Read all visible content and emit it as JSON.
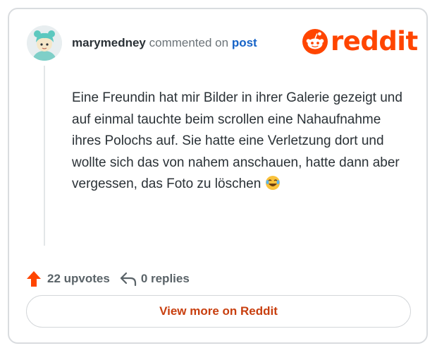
{
  "comment": {
    "username": "marymedney",
    "action_text": "commented on",
    "post_link": "post",
    "body": "Eine Freundin hat mir Bilder in ihrer Galerie gezeigt und auf einmal tauchte beim scrollen eine Nahaufnahme ihres Polochs auf. Sie hatte eine Verletzung dort und wollte sich das von nahem anschauen, hatte dann aber vergessen, das Foto zu löschen",
    "emoji": "face-with-tears-of-joy-icon"
  },
  "brand": {
    "logo_text": "reddit",
    "color": "#ff4500"
  },
  "footer": {
    "upvotes": "22 upvotes",
    "replies": "0 replies",
    "upvote_icon": "upvote-arrow-icon",
    "reply_icon": "reply-arrow-icon",
    "upvote_color": "#ff4500"
  },
  "cta": {
    "label": "View more on Reddit",
    "color": "#c83f0f"
  }
}
